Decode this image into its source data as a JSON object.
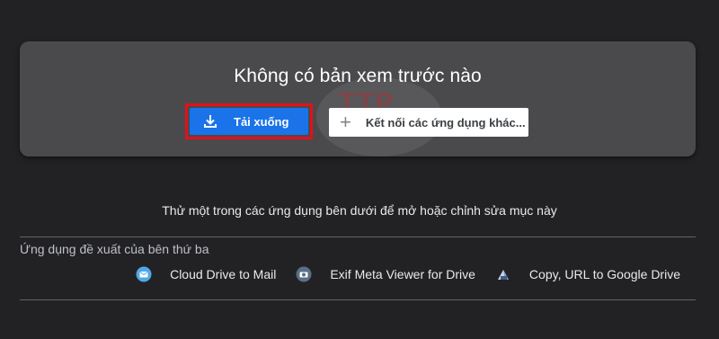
{
  "preview": {
    "title": "Không có bản xem trước nào",
    "download_label": "Tải xuống",
    "connect_label": "Kết nối các ứng dụng khác...",
    "watermark_text": "TTP"
  },
  "suggestions": {
    "try_text": "Thử một trong các ứng dụng bên dưới để mở hoặc chỉnh sửa mục này",
    "section_label": "Ứng dụng đề xuất của bên thứ ba",
    "apps": [
      {
        "name": "Cloud Drive to Mail",
        "icon": "mail-icon"
      },
      {
        "name": "Exif Meta Viewer for Drive",
        "icon": "camera-icon"
      },
      {
        "name": "Copy, URL to Google Drive",
        "icon": "drive-upload-icon"
      }
    ]
  },
  "colors": {
    "background": "#222225",
    "card": "#4a494c",
    "accent": "#1a73e8",
    "highlight": "#e3101a"
  }
}
